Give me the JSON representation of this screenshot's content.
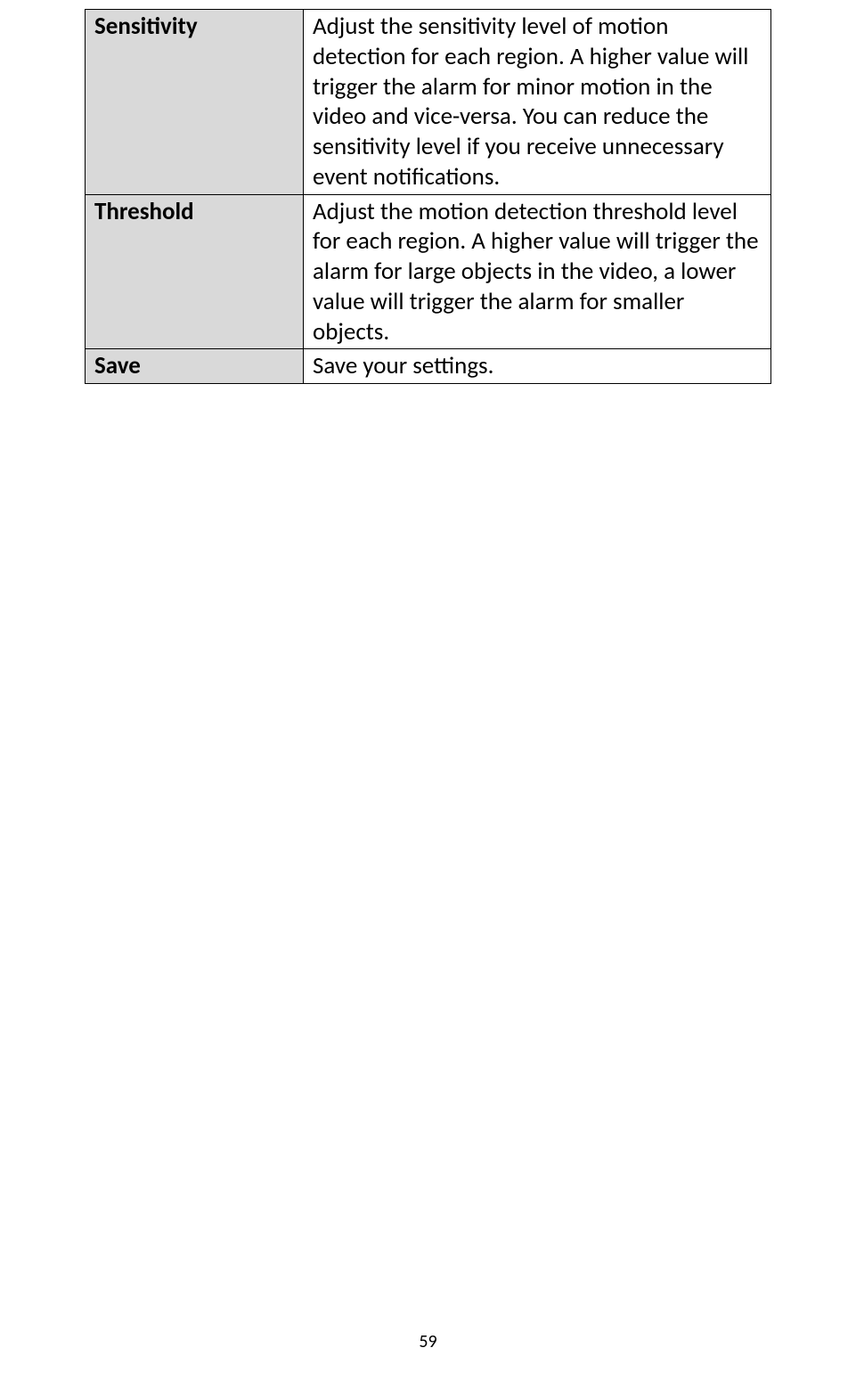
{
  "table": {
    "rows": [
      {
        "label": "Sensitivity",
        "description": "Adjust the sensitivity level of motion detection for each region. A higher value will trigger the alarm for minor motion in the video and vice-versa. You can reduce the sensitivity level if you receive unnecessary event notifications."
      },
      {
        "label": "Threshold",
        "description": "Adjust the motion detection threshold level for each region. A higher value will trigger the alarm for large objects in the video, a lower value will trigger the alarm for smaller objects."
      },
      {
        "label": "Save",
        "description": "Save your settings."
      }
    ]
  },
  "page_number": "59"
}
